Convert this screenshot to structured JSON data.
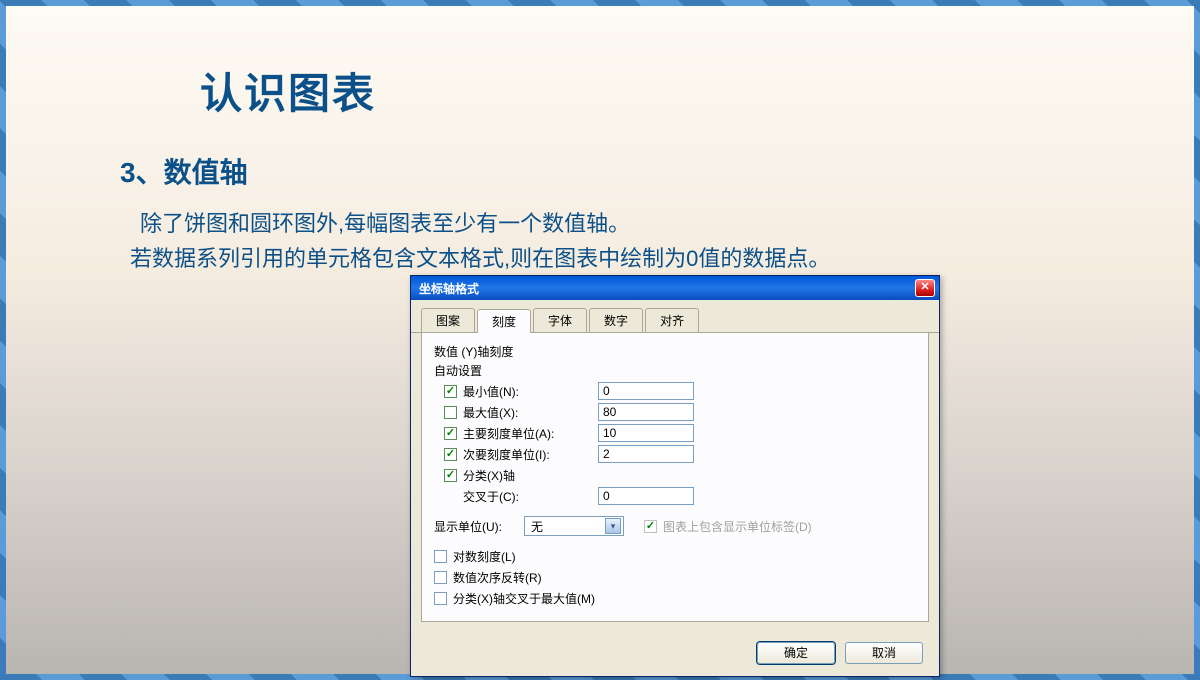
{
  "slide": {
    "title": "认识图表",
    "section_heading": "3、数值轴",
    "body_line1": "除了饼图和圆环图外,每幅图表至少有一个数值轴。",
    "body_line2": "若数据系列引用的单元格包含文本格式,则在图表中绘制为0值的数据点。"
  },
  "dialog": {
    "title": "坐标轴格式",
    "tabs": {
      "pattern": "图案",
      "scale": "刻度",
      "font": "字体",
      "number": "数字",
      "align": "对齐"
    },
    "scale_header": "数值 (Y)轴刻度",
    "auto_set": "自动设置",
    "rows": {
      "min": {
        "label": "最小值(N):",
        "value": "0",
        "checked": true
      },
      "max": {
        "label": "最大值(X):",
        "value": "80",
        "checked": false
      },
      "major": {
        "label": "主要刻度单位(A):",
        "value": "10",
        "checked": true
      },
      "minor": {
        "label": "次要刻度单位(I):",
        "value": "2",
        "checked": true
      },
      "category": {
        "label": "分类(X)轴",
        "checked": true
      },
      "cross_at": {
        "label": "交叉于(C):",
        "value": "0"
      }
    },
    "display_unit": {
      "label": "显示单位(U):",
      "value": "无"
    },
    "show_unit_label": "图表上包含显示单位标签(D)",
    "lower": {
      "log": "对数刻度(L)",
      "reverse": "数值次序反转(R)",
      "cross_max": "分类(X)轴交叉于最大值(M)"
    },
    "buttons": {
      "ok": "确定",
      "cancel": "取消"
    }
  }
}
